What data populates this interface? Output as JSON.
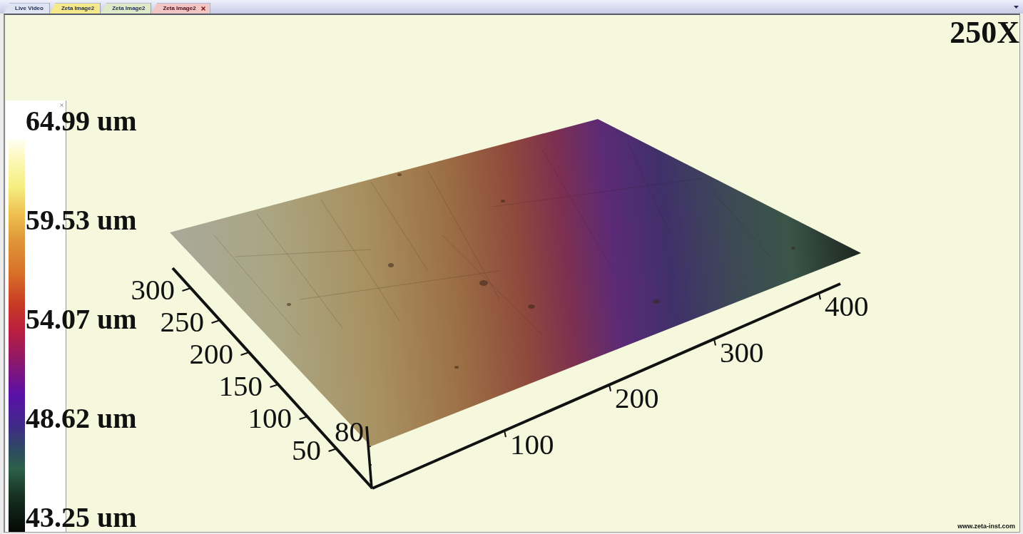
{
  "tabs": [
    {
      "label": "Live Video",
      "selected": false,
      "color": "#dfe4f2"
    },
    {
      "label": "Zeta Image2",
      "selected": false,
      "color": "#f6e98a"
    },
    {
      "label": "Zeta Image2",
      "selected": false,
      "color": "#e0eac8"
    },
    {
      "label": "Zeta Image2",
      "selected": true,
      "color": "#f1c6c4"
    }
  ],
  "magnification": "250X",
  "color_scale": {
    "labels": [
      "64.99 um",
      "59.53 um",
      "54.07 um",
      "48.62 um",
      "43.25 um"
    ]
  },
  "plot": {
    "y_axis_ticks": [
      "300",
      "250",
      "200",
      "150",
      "100",
      "50"
    ],
    "z_axis_ticks": [
      "80"
    ],
    "x_axis_ticks": [
      "100",
      "200",
      "300",
      "400"
    ]
  },
  "footer": {
    "website": "www.zeta-inst.com"
  }
}
